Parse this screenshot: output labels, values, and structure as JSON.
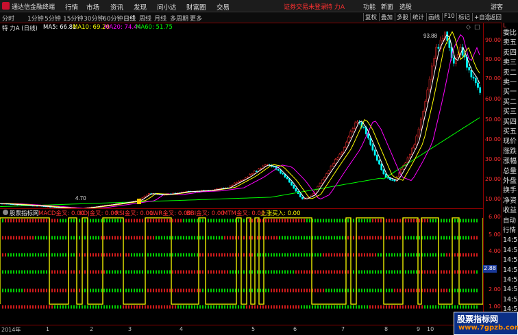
{
  "titlebar": {
    "app_name": "通达信金融终端",
    "menus": [
      "行情",
      "市场",
      "资讯",
      "发现",
      "问小达",
      "财富圈",
      "交易"
    ],
    "warning": "证券交易未登录",
    "stock": "特 力A",
    "right_menus": [
      "功能",
      "新面",
      "选股",
      "游客"
    ]
  },
  "toolbar": {
    "periods": [
      "分时",
      "1分钟",
      "5分钟",
      "15分钟",
      "30分钟",
      "60分钟",
      "日线",
      "周线",
      "月线",
      "多周期",
      "更多"
    ],
    "active_period": "日线",
    "buttons": [
      "复权",
      "叠加",
      "多股",
      "统计",
      "画线",
      "F10",
      "标记",
      "+自选",
      "返回"
    ]
  },
  "ma_row": {
    "title": "特 力A (日线)",
    "ma5_label": "MA5: 66.81",
    "ma10_label": "MA10: 69.20",
    "ma20_label": "MA20: 74.44",
    "ma60_label": "MA60: 51.75"
  },
  "price_chart": {
    "high_label": "93.88",
    "low_label": "4.70",
    "yticks": [
      "90.00",
      "80.00",
      "70.00",
      "60.00",
      "50.00",
      "40.00",
      "30.00",
      "20.00",
      "10.00"
    ],
    "colors": {
      "up": "#ff3030",
      "down": "#00ffff",
      "ma5": "#ffffff",
      "ma10": "#ffff00",
      "ma20": "#ff00ff",
      "ma60": "#00ff00"
    }
  },
  "indicator_row": {
    "name": "股票指标网",
    "labels": [
      "MACD金叉: 0.00",
      "KDJ金叉: 0.00",
      "RSI金叉: 0.00",
      "LWR金叉: 0.00",
      "BBI金叉: 0.00",
      "MTM金叉: 0.00",
      "上涨买入: 0.00"
    ],
    "yticks": [
      "6.00",
      "5.00",
      "4.00",
      "3.00",
      "2.00",
      "1.00"
    ],
    "current_value": "2.88"
  },
  "xaxis": {
    "year_label": "2014年",
    "months": [
      "1",
      "2",
      "3",
      "4",
      "5",
      "6",
      "7",
      "8",
      "9",
      "10"
    ]
  },
  "right_panel": {
    "header": "L",
    "items": [
      "委比",
      "卖五",
      "卖四",
      "卖三",
      "卖二",
      "卖一",
      "买一",
      "买二",
      "买三",
      "买四",
      "买五",
      "现价",
      "涨跌",
      "涨幅",
      "总量",
      "外盘",
      "换手",
      "净资",
      "收益",
      "自动",
      "行情",
      "14:5",
      "14:5",
      "14:5",
      "14:5",
      "14:5",
      "14:5",
      "14:5",
      "14:5"
    ]
  },
  "watermark": {
    "line1": "股票指标网",
    "line2": "www.7gpzb.com"
  }
}
